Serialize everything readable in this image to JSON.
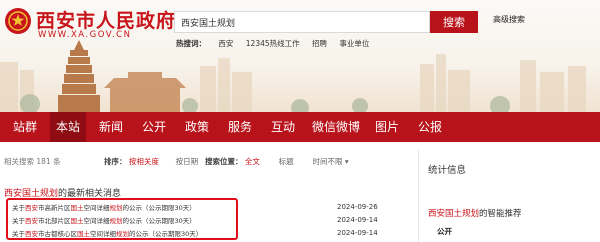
{
  "header": {
    "site_title": "西安市人民政府",
    "site_url": "WWW.XA.GOV.CN",
    "search_value": "西安国土规划",
    "search_button": "搜索",
    "advanced_search": "高级搜索",
    "hot_label": "热搜词：",
    "hot_words": [
      "西安",
      "12345热线工作",
      "招聘",
      "事业单位"
    ]
  },
  "nav": {
    "items": [
      "站群",
      "本站",
      "新闻",
      "公开",
      "政策",
      "服务",
      "互动",
      "微信微博",
      "图片",
      "公报"
    ],
    "active": "本站"
  },
  "filters": {
    "count_text": "相关搜索 181 条",
    "sort_label": "排序：",
    "sort_options": [
      "按相关度",
      "按日期"
    ],
    "position_label": "搜索位置：",
    "position_options": [
      "全文",
      "标题"
    ],
    "time_label": "时间不限",
    "time_caret": "▾"
  },
  "results": {
    "header_highlight": "西安国土规划",
    "header_rest": "的最新相关消息",
    "items": [
      {
        "p1": "关于",
        "h1": "西安",
        "p2": "市高新片区",
        "h2": "国土",
        "p3": "空间详细",
        "h3": "规划",
        "p4": "的公示（公示期限30天）",
        "date": "2024-09-26"
      },
      {
        "p1": "关于",
        "h1": "西安",
        "p2": "市北部片区",
        "h2": "国土",
        "p3": "空间详细",
        "h3": "规划",
        "p4": "的公示（公示期限30天）",
        "date": "2024-09-14"
      },
      {
        "p1": "关于",
        "h1": "西安",
        "p2": "市古都核心区",
        "h2": "国土",
        "p3": "空间详细",
        "h3": "规划",
        "p4": "的公示（公示期限30天）",
        "date": "2024-09-14"
      }
    ]
  },
  "sidebar": {
    "stats_title": "统计信息",
    "intel_highlight": "西安国土规划",
    "intel_rest": "的智能推荐",
    "public_label": "公开"
  },
  "colors": {
    "brand_red": "#b8121a",
    "highlight_red": "#c8141b",
    "annotation_box": "#e0101a"
  }
}
